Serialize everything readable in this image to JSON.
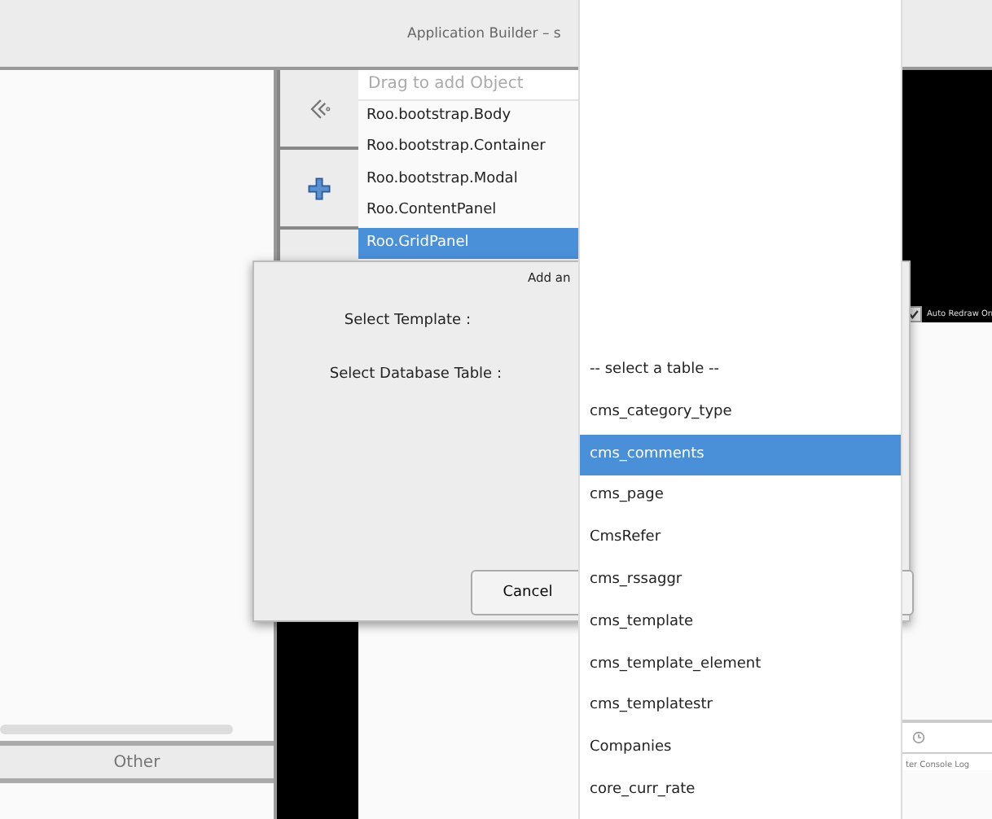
{
  "window": {
    "title": "Application Builder – s"
  },
  "left_panel": {
    "tab": "Other"
  },
  "toolbar": [
    {
      "kind": "back"
    },
    {
      "kind": "add"
    },
    {
      "kind": "blank"
    }
  ],
  "object_list": {
    "placeholder": "Drag to add Object",
    "items": [
      {
        "label": "Roo.bootstrap.Body",
        "selected": false
      },
      {
        "label": "Roo.bootstrap.Container",
        "selected": false
      },
      {
        "label": "Roo.bootstrap.Modal",
        "selected": false
      },
      {
        "label": "Roo.ContentPanel",
        "selected": false
      },
      {
        "label": "Roo.GridPanel",
        "selected": true
      }
    ]
  },
  "preview": {
    "auto_redraw": {
      "label": "Auto Redraw On",
      "checked": true
    },
    "console_tab": "ter Console Log"
  },
  "dialog": {
    "title": "Add an",
    "fields": [
      {
        "label": "Select Template :"
      },
      {
        "label": "Select Database Table :"
      }
    ],
    "buttons": [
      "Cancel"
    ]
  },
  "table_dropdown": {
    "options": [
      {
        "label": "-- select a table --",
        "selected": false
      },
      {
        "label": "cms_category_type",
        "selected": false
      },
      {
        "label": "cms_comments",
        "selected": true
      },
      {
        "label": "cms_page",
        "selected": false
      },
      {
        "label": "CmsRefer",
        "selected": false
      },
      {
        "label": "cms_rssaggr",
        "selected": false
      },
      {
        "label": "cms_template",
        "selected": false
      },
      {
        "label": "cms_template_element",
        "selected": false
      },
      {
        "label": "cms_templatestr",
        "selected": false
      },
      {
        "label": "Companies",
        "selected": false
      },
      {
        "label": "core_curr_rate",
        "selected": false
      }
    ]
  }
}
